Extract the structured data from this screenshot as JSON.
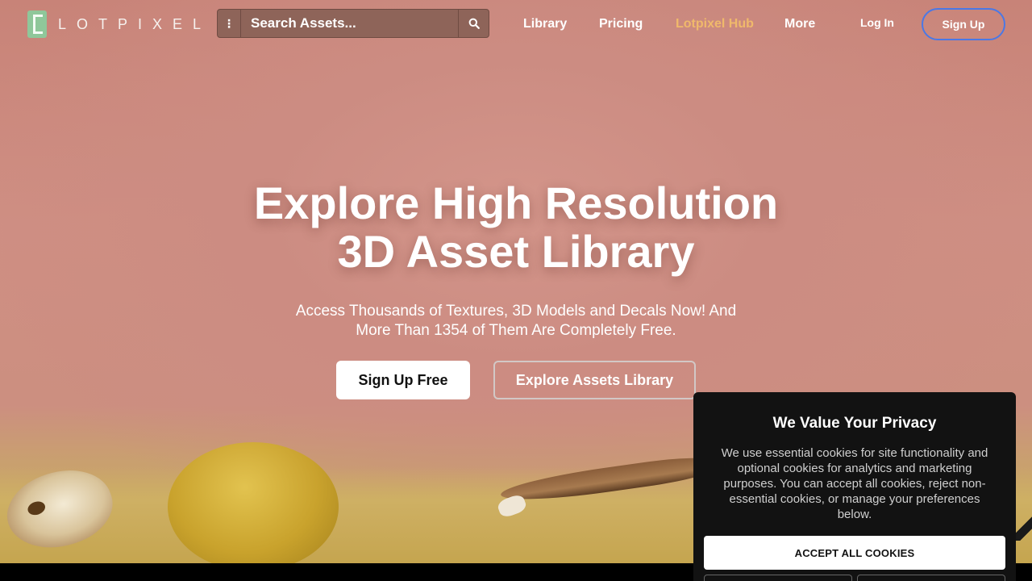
{
  "header": {
    "logo_text": "LOTPIXEL",
    "search": {
      "placeholder": "Search Assets..."
    },
    "nav": [
      {
        "label": "Library"
      },
      {
        "label": "Pricing"
      },
      {
        "label": "Lotpixel Hub"
      },
      {
        "label": "More"
      }
    ],
    "login_label": "Log In",
    "signup_label": "Sign Up"
  },
  "hero": {
    "title_line1": "Explore High Resolution",
    "title_line2": "3D Asset Library",
    "subtitle_line1": "Access Thousands of Textures, 3D Models and Decals Now! And",
    "subtitle_line2": "More Than 1354 of Them Are Completely Free.",
    "cta_primary": "Sign Up Free",
    "cta_secondary": "Explore Assets Library"
  },
  "cookie": {
    "title": "We Value Your Privacy",
    "body": "We use essential cookies for site functionality and optional cookies for analytics and marketing purposes. You can accept all cookies, reject non-essential cookies, or manage your preferences below.",
    "accept_label": "ACCEPT ALL COOKIES"
  },
  "colors": {
    "hero_bg": "#cc8c82",
    "accent_link": "#f0b96b",
    "signup_border": "#4a78e6",
    "logo_mark": "#8fc79a",
    "cookie_bg": "#121212"
  }
}
